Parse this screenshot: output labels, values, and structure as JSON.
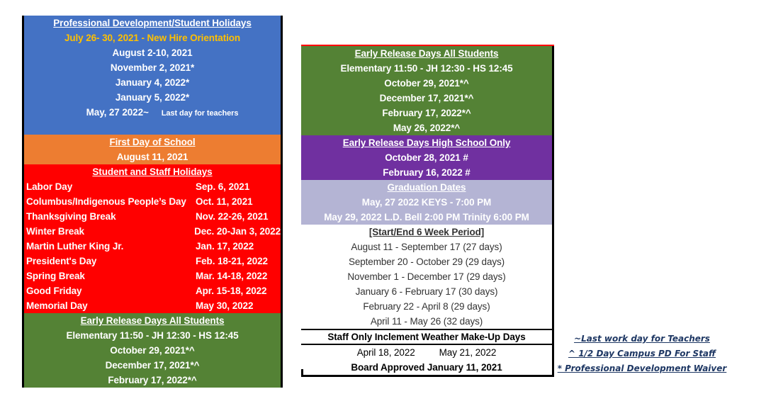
{
  "left": {
    "pd": {
      "header": "Professional Development/Student Holidays",
      "new_hire": "July 26- 30, 2021 -  New Hire Orientation",
      "dates": [
        "August 2-10, 2021",
        "November 2, 2021*",
        "January 4, 2022*",
        "January 5, 2022*"
      ],
      "last_day": "May, 27 2022~",
      "last_day_note": "Last day for teachers"
    },
    "first_day": {
      "header": "First Day of School",
      "date": "August 11, 2021"
    },
    "holidays": {
      "header": "Student and Staff Holidays",
      "items": [
        {
          "name": "Labor Day",
          "date": "Sep. 6, 2021"
        },
        {
          "name": "Columbus/Indigenous People’s Day",
          "date": "Oct. 11, 2021"
        },
        {
          "name": "Thanksgiving Break",
          "date": "Nov. 22-26, 2021"
        },
        {
          "name": "Winter Break",
          "date": "Dec. 20-Jan 3, 2022"
        },
        {
          "name": "Martin Luther King Jr.",
          "date": "Jan. 17, 2022"
        },
        {
          "name": "President's Day",
          "date": "Feb. 18-21, 2022"
        },
        {
          "name": "Spring Break",
          "date": "Mar. 14-18, 2022"
        },
        {
          "name": "Good Friday",
          "date": "Apr. 15-18, 2022"
        },
        {
          "name": "Memorial Day",
          "date": "May 30, 2022"
        }
      ]
    },
    "early_release": {
      "header": "Early Release Days All Students",
      "times": "Elementary 11:50 - JH 12:30 - HS 12:45",
      "dates": [
        "October 29, 2021*^",
        "December 17, 2021*^",
        "February 17, 2022*^"
      ]
    }
  },
  "right": {
    "early_release": {
      "header": "Early Release Days All Students",
      "times": "Elementary 11:50 - JH 12:30 - HS 12:45",
      "dates": [
        "October 29, 2021*^",
        "December 17, 2021*^",
        "February 17, 2022*^",
        "May 26, 2022*^"
      ]
    },
    "hs_early": {
      "header": "Early Release Days High School Only",
      "dates": [
        "October 28, 2021 #",
        "February 16, 2022 #"
      ]
    },
    "graduation": {
      "header": "Graduation Dates",
      "lines": [
        "May, 27 2022 KEYS - 7:00 PM",
        "May 29, 2022 L.D. Bell 2:00 PM   Trinity 6:00 PM"
      ]
    },
    "periods": {
      "header": "[Start/End 6 Week Period]",
      "items": [
        "August 11 - September 17 (27 days)",
        "September 20 - October 29 (29 days)",
        "November 1 - December 17 (29 days)",
        "January 6 - February 17  (30 days)",
        "February 22 - April  8 (29 days)",
        "April 11 - May 26 (32 days)"
      ]
    },
    "weather": {
      "header": "Staff Only Inclement Weather Make-Up Days",
      "date1": "April 18, 2022",
      "date2": "May 21, 2022"
    },
    "board": "Board Approved January 11, 2021"
  },
  "legend": [
    "~Last work day for Teachers",
    "^ 1/2 Day Campus PD For Staff",
    "* Professional Development Waiver"
  ],
  "colors": {
    "pd_blue": "#4472c4",
    "first_day_orange": "#ed7d31",
    "holiday_red": "#ff0000",
    "early_release_green": "#548235",
    "hs_purple": "#7030a0",
    "graduation_lavender": "#b4b4d4",
    "new_hire_yellow": "#ffc000"
  }
}
